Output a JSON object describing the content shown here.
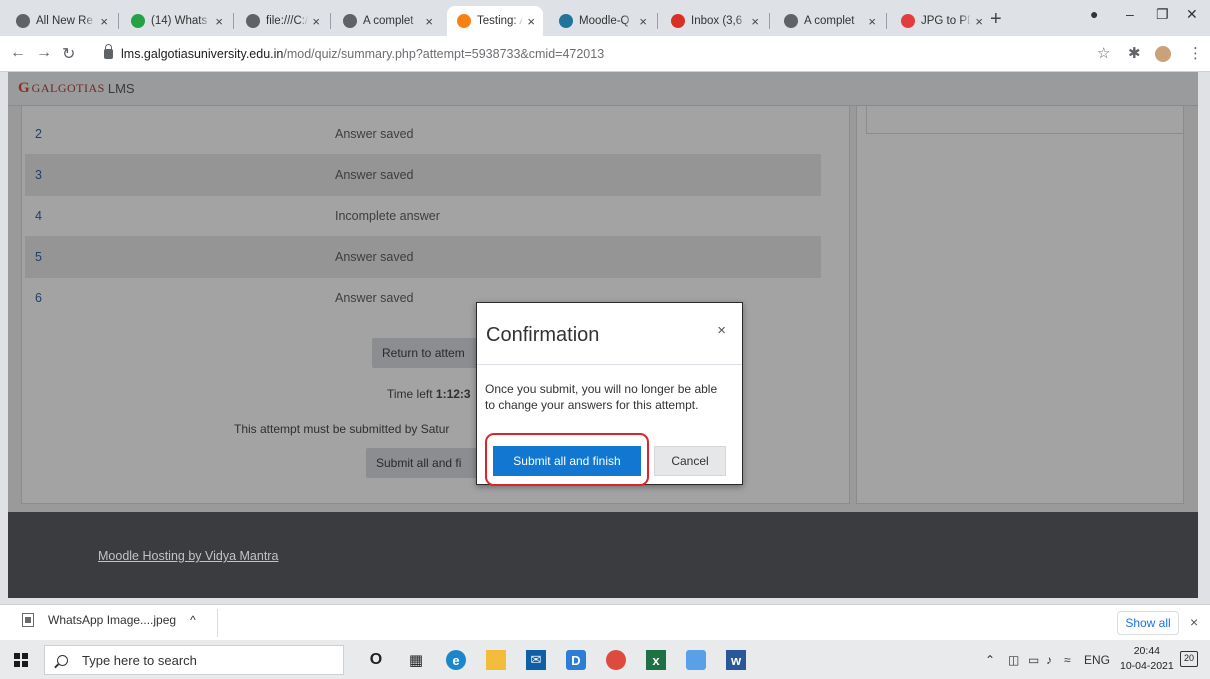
{
  "browser": {
    "tabs": [
      {
        "label": "All New Re",
        "icon": "globe-icon",
        "color": "#5f6368"
      },
      {
        "label": "(14) Whats",
        "icon": "whatsapp-icon",
        "color": "#25a244"
      },
      {
        "label": "file:///C:/U",
        "icon": "globe-icon",
        "color": "#5f6368"
      },
      {
        "label": "A complet",
        "icon": "globe-icon",
        "color": "#5f6368"
      },
      {
        "label": "Testing: At",
        "icon": "moodle-icon",
        "color": "#f98012",
        "active": true
      },
      {
        "label": "Moodle-Q",
        "icon": "wordpress-icon",
        "color": "#21759b"
      },
      {
        "label": "Inbox (3,6",
        "icon": "gmail-icon",
        "color": "#d93025"
      },
      {
        "label": "A complet",
        "icon": "globe-icon",
        "color": "#5f6368"
      },
      {
        "label": "JPG to PDF",
        "icon": "jpg2pdf-icon",
        "color": "#e23c3c"
      }
    ],
    "new_tab": "+",
    "url_domain": "lms.galgotiasuniversity.edu.in",
    "url_path": "/mod/quiz/summary.php?attempt=5938733&cmid=472013"
  },
  "site": {
    "brand": "GALGOTIAS",
    "brand_suffix": "LMS"
  },
  "summary": {
    "rows": [
      {
        "num": "2",
        "status": "Answer saved"
      },
      {
        "num": "3",
        "status": "Answer saved"
      },
      {
        "num": "4",
        "status": "Incomplete answer"
      },
      {
        "num": "5",
        "status": "Answer saved"
      },
      {
        "num": "6",
        "status": "Answer saved"
      }
    ],
    "return_button": "Return to attem",
    "time_left_label": "Time left ",
    "time_left_value": "1:12:3",
    "deadline_text": "This attempt must be submitted by Satur",
    "submit_button_bg": "Submit all and fi"
  },
  "footer": {
    "link": "Moodle Hosting by Vidya Mantra"
  },
  "modal": {
    "title": "Confirmation",
    "close": "×",
    "body": "Once you submit, you will no longer be able to change your answers for this attempt.",
    "submit": "Submit all and finish",
    "cancel": "Cancel",
    "accent": "#1177d1",
    "highlight": "#e0232a"
  },
  "downloads": {
    "file": "WhatsApp Image....jpeg",
    "caret": "^",
    "show_all": "Show all",
    "close": "×"
  },
  "taskbar": {
    "search_placeholder": "Type here to search",
    "lang": "ENG",
    "time": "20:44",
    "date": "10-04-2021",
    "notifications": "20"
  }
}
